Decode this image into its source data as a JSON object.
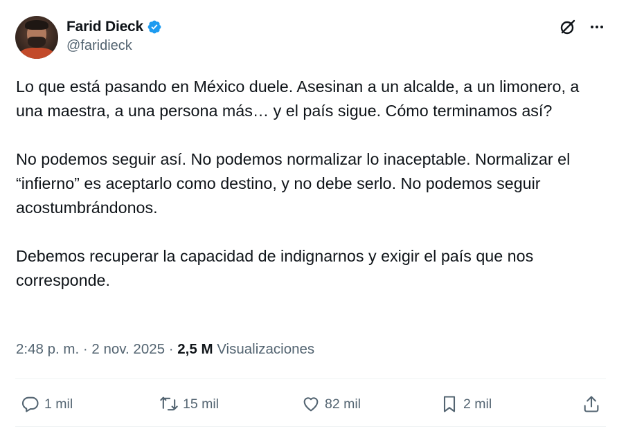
{
  "author": {
    "display_name": "Farid Dieck",
    "handle": "@faridieck",
    "verified": true
  },
  "tweet": {
    "paragraphs": [
      "Lo que está pasando en México duele. Asesinan a un alcalde, a un limonero, a una maestra, a una persona más… y el país sigue. Cómo terminamos así?",
      "No podemos seguir así. No podemos normalizar lo inaceptable. Normalizar el “infierno” es aceptarlo como destino, y no debe serlo. No podemos seguir acostumbrándonos.",
      "Debemos recuperar la capacidad de indignarnos y exigir el país que nos corresponde."
    ]
  },
  "meta": {
    "time": "2:48 p. m.",
    "separator": "·",
    "date": "2 nov. 2025",
    "views_count": "2,5 M",
    "views_label": "Visualizaciones"
  },
  "actions": {
    "replies": "1 mil",
    "reposts": "15 mil",
    "likes": "82 mil",
    "bookmarks": "2 mil"
  },
  "colors": {
    "text": "#0f1419",
    "secondary": "#536471",
    "verified": "#1d9bf0",
    "divider": "#eff3f4"
  },
  "icons": {
    "verified": "verified-badge-icon",
    "grok": "grok-icon",
    "more": "more-icon",
    "reply": "reply-icon",
    "repost": "repost-icon",
    "like": "like-icon",
    "bookmark": "bookmark-icon",
    "share": "share-icon"
  }
}
